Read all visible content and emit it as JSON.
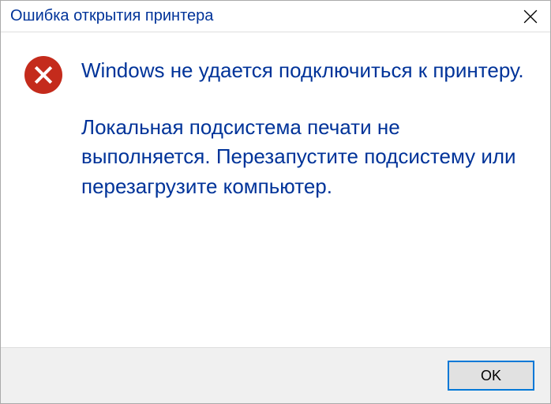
{
  "dialog": {
    "title": "Ошибка открытия принтера",
    "message_primary": "Windows не удается подключиться к принтеру.",
    "message_secondary": "Локальная подсистема печати не выполняется. Перезапустите подсистему или перезагрузите компьютер.",
    "ok_label": "OK"
  },
  "icons": {
    "error": "error-icon",
    "close": "close-icon"
  },
  "colors": {
    "accent": "#003399",
    "error": "#c42b1c",
    "focus_border": "#0078d7"
  }
}
